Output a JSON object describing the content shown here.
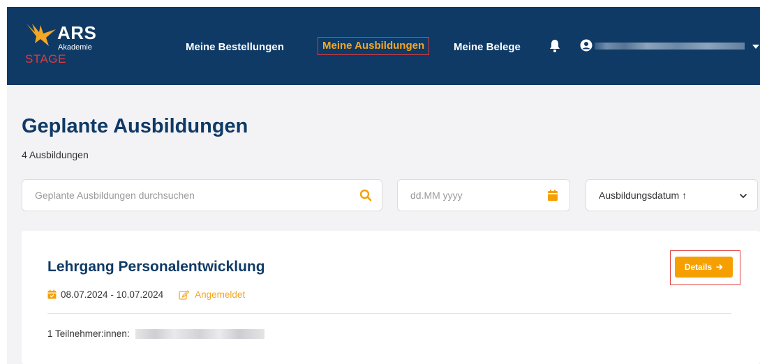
{
  "colors": {
    "header_bg": "#0f3a66",
    "accent": "#f5a623",
    "button": "#f5a000",
    "highlight_outline": "#e23a3a",
    "title": "#0f3a66"
  },
  "header": {
    "logo": {
      "brand": "ARS",
      "subtitle": "Akademie",
      "env": "STAGE"
    },
    "nav": [
      {
        "label": "Meine Bestellungen",
        "active": false
      },
      {
        "label": "Meine Ausbildungen",
        "active": true
      },
      {
        "label": "Meine Belege",
        "active": false
      }
    ],
    "icons": {
      "notifications": "bell-icon",
      "user": "user-circle-icon",
      "menu": "caret-down-icon"
    }
  },
  "page": {
    "title": "Geplante Ausbildungen",
    "count_text": "4 Ausbildungen"
  },
  "filters": {
    "search": {
      "placeholder": "Geplante Ausbildungen durchsuchen",
      "value": "",
      "icon": "search-icon"
    },
    "date": {
      "placeholder": "dd.MM yyyy",
      "value": "",
      "icon": "calendar-icon"
    },
    "sort": {
      "value": "Ausbildungsdatum ↑",
      "icon": "chevron-down-icon"
    }
  },
  "courses": [
    {
      "title": "Lehrgang Personalentwicklung",
      "dates": "08.07.2024 - 10.07.2024",
      "status": "Angemeldet",
      "participants_label": "1 Teilnehmer:innen:",
      "details_label": "Details"
    }
  ]
}
